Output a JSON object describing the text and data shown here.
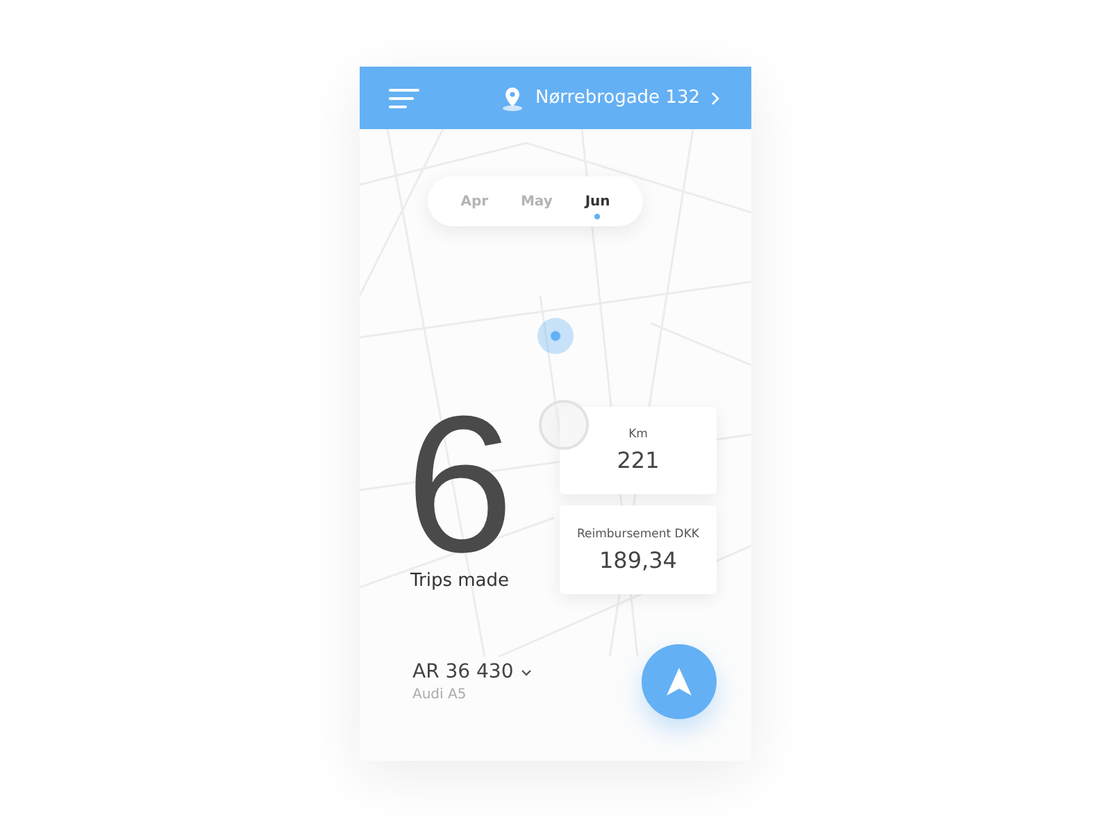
{
  "header": {
    "location": "Nørrebrogade 132"
  },
  "months": [
    {
      "label": "Apr",
      "selected": false
    },
    {
      "label": "May",
      "selected": false
    },
    {
      "label": "Jun",
      "selected": true
    }
  ],
  "trips": {
    "count": "6",
    "label": "Trips made"
  },
  "stats": [
    {
      "label": "Km",
      "value": "221"
    },
    {
      "label": "Reimbursement DKK",
      "value": "189,34"
    }
  ],
  "vehicle": {
    "plate": "AR 36 430",
    "model": "Audi A5"
  }
}
